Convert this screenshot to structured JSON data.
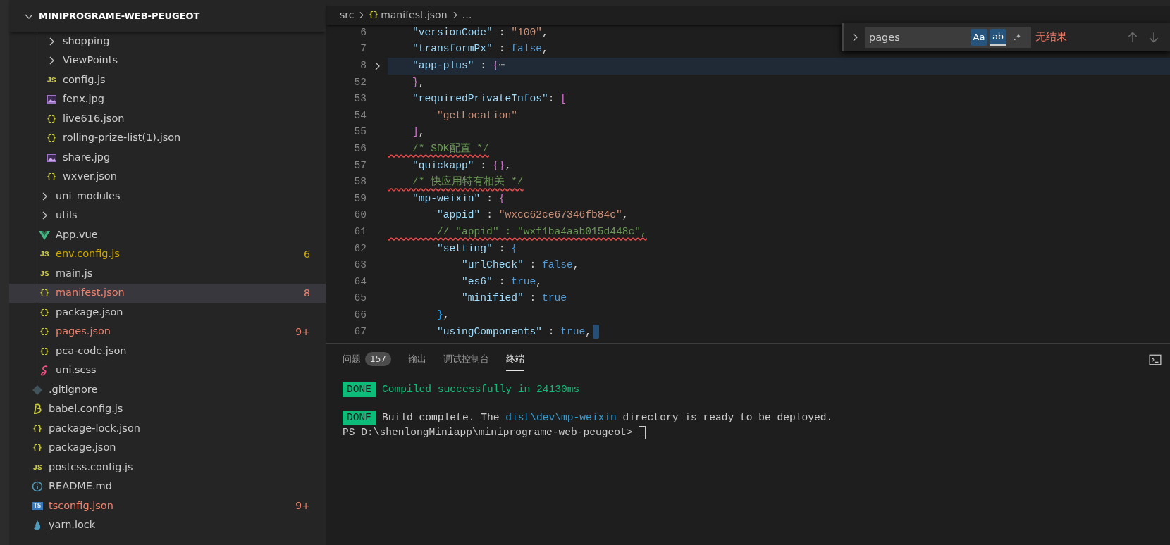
{
  "sidebar": {
    "root": {
      "label": "MINIPROGRAME-WEB-PEUGEOT",
      "expanded": true,
      "children": [
        {
          "children": [
            {
              "children": [
                {
                  "label": "shopping",
                  "kind": "folder",
                  "expanded": false,
                  "selected": false
                },
                {
                  "label": "ViewPoints",
                  "kind": "folder",
                  "expanded": false,
                  "selected": false
                },
                {
                  "label": "config.js",
                  "kind": "js",
                  "icon": "JS",
                  "selected": false
                },
                {
                  "label": "fenx.jpg",
                  "kind": "image",
                  "selected": false
                },
                {
                  "label": "live616.json",
                  "kind": "json",
                  "icon": "{}",
                  "selected": false
                },
                {
                  "label": "rolling-prize-list(1).json",
                  "kind": "json",
                  "icon": "{}",
                  "selected": false
                },
                {
                  "label": "share.jpg",
                  "kind": "image",
                  "selected": false
                },
                {
                  "label": "wxver.json",
                  "kind": "json",
                  "icon": "{}",
                  "selected": false
                }
              ]
            },
            {
              "label": "uni_modules",
              "kind": "folder",
              "expanded": false,
              "selected": false
            },
            {
              "label": "utils",
              "kind": "folder",
              "expanded": false,
              "selected": false
            },
            {
              "label": "App.vue",
              "kind": "vue",
              "selected": false
            },
            {
              "label": "env.config.js",
              "kind": "js",
              "icon": "JS",
              "selected": false,
              "warning": true,
              "badge": "6"
            },
            {
              "label": "main.js",
              "kind": "js",
              "icon": "JS",
              "selected": false
            },
            {
              "label": "manifest.json",
              "kind": "json",
              "icon": "{}",
              "selected": true,
              "error": true,
              "badge": "8"
            },
            {
              "label": "package.json",
              "kind": "json",
              "icon": "{}",
              "selected": false
            },
            {
              "label": "pages.json",
              "kind": "json",
              "icon": "{}",
              "selected": false,
              "error": true,
              "badge": "9+"
            },
            {
              "label": "pca-code.json",
              "kind": "json",
              "icon": "{}",
              "selected": false
            },
            {
              "label": "uni.scss",
              "kind": "scss",
              "selected": false
            }
          ]
        },
        {
          "label": ".gitignore",
          "kind": "git",
          "selected": false
        },
        {
          "label": "babel.config.js",
          "kind": "babel",
          "selected": false
        },
        {
          "label": "package-lock.json",
          "kind": "json",
          "icon": "{}",
          "selected": false
        },
        {
          "label": "package.json",
          "kind": "json",
          "icon": "{}",
          "selected": false
        },
        {
          "label": "postcss.config.js",
          "kind": "js",
          "icon": "JS",
          "selected": false
        },
        {
          "label": "README.md",
          "kind": "info",
          "selected": false
        },
        {
          "label": "tsconfig.json",
          "kind": "ts",
          "icon": "TS",
          "selected": false,
          "error": true,
          "badge": "9+"
        },
        {
          "label": "yarn.lock",
          "kind": "yarn",
          "selected": false
        }
      ]
    }
  },
  "breadcrumb": [
    {
      "text": "src"
    },
    {
      "text": "manifest.json",
      "icon": "{}"
    },
    {
      "text": "…"
    }
  ],
  "code": [
    {
      "number": "6",
      "folded": false,
      "tokens": [
        {
          "kind": "key",
          "text": "    \"versionCode\""
        },
        {
          "kind": "punct",
          "text": " : "
        },
        {
          "kind": "str",
          "text": "\"100\""
        },
        {
          "kind": "punct",
          "text": ","
        }
      ]
    },
    {
      "number": "7",
      "folded": false,
      "tokens": [
        {
          "kind": "key",
          "text": "    \"transformPx\""
        },
        {
          "kind": "punct",
          "text": " : "
        },
        {
          "kind": "bool",
          "text": "false"
        },
        {
          "kind": "punct",
          "text": ","
        }
      ]
    },
    {
      "number": "8",
      "folded": true,
      "tokens": [
        {
          "kind": "key",
          "text": "    \"app-plus\""
        },
        {
          "kind": "punct",
          "text": " : "
        },
        {
          "kind": "b1",
          "text": "{"
        },
        {
          "kind": "ellipsis",
          "text": "⋯"
        }
      ]
    },
    {
      "number": "52",
      "folded": false,
      "tokens": [
        {
          "kind": "b1",
          "text": "    }"
        },
        {
          "kind": "punct",
          "text": ","
        }
      ]
    },
    {
      "number": "53",
      "folded": false,
      "tokens": [
        {
          "kind": "key",
          "text": "    \"requiredPrivateInfos\""
        },
        {
          "kind": "punct",
          "text": ": "
        },
        {
          "kind": "b1",
          "text": "["
        }
      ]
    },
    {
      "number": "54",
      "folded": false,
      "tokens": [
        {
          "kind": "str",
          "text": "        \"getLocation\""
        }
      ]
    },
    {
      "number": "55",
      "folded": false,
      "tokens": [
        {
          "kind": "b1",
          "text": "    ]"
        },
        {
          "kind": "punct",
          "text": ","
        }
      ]
    },
    {
      "number": "56",
      "folded": false,
      "tokens": [
        {
          "kind": "comment",
          "text": "    /* SDK配置 */",
          "error": true
        }
      ]
    },
    {
      "number": "57",
      "folded": false,
      "tokens": [
        {
          "kind": "key",
          "text": "    \"quickapp\""
        },
        {
          "kind": "punct",
          "text": " : "
        },
        {
          "kind": "b1",
          "text": "{}"
        },
        {
          "kind": "punct",
          "text": ","
        }
      ]
    },
    {
      "number": "58",
      "folded": false,
      "tokens": [
        {
          "kind": "comment",
          "text": "    /* 快应用特有相关 */",
          "error": true
        }
      ]
    },
    {
      "number": "59",
      "folded": false,
      "tokens": [
        {
          "kind": "key",
          "text": "    \"mp-weixin\""
        },
        {
          "kind": "punct",
          "text": " : "
        },
        {
          "kind": "b1",
          "text": "{"
        }
      ]
    },
    {
      "number": "60",
      "folded": false,
      "tokens": [
        {
          "kind": "key",
          "text": "        \"appid\""
        },
        {
          "kind": "punct",
          "text": " : "
        },
        {
          "kind": "str",
          "text": "\"wxcc62ce67346fb84c\""
        },
        {
          "kind": "punct",
          "text": ","
        }
      ]
    },
    {
      "number": "61",
      "folded": false,
      "tokens": [
        {
          "kind": "comment",
          "text": "        // \"appid\" : \"wxf1ba4aab015d448c\",",
          "error": true
        }
      ]
    },
    {
      "number": "62",
      "folded": false,
      "tokens": [
        {
          "kind": "key",
          "text": "        \"setting\""
        },
        {
          "kind": "punct",
          "text": " : "
        },
        {
          "kind": "b2",
          "text": "{"
        }
      ]
    },
    {
      "number": "63",
      "folded": false,
      "tokens": [
        {
          "kind": "key",
          "text": "            \"urlCheck\""
        },
        {
          "kind": "punct",
          "text": " : "
        },
        {
          "kind": "bool",
          "text": "false"
        },
        {
          "kind": "punct",
          "text": ","
        }
      ]
    },
    {
      "number": "64",
      "folded": false,
      "tokens": [
        {
          "kind": "key",
          "text": "            \"es6\""
        },
        {
          "kind": "punct",
          "text": " : "
        },
        {
          "kind": "bool",
          "text": "true"
        },
        {
          "kind": "punct",
          "text": ","
        }
      ]
    },
    {
      "number": "65",
      "folded": false,
      "tokens": [
        {
          "kind": "key",
          "text": "            \"minified\""
        },
        {
          "kind": "punct",
          "text": " : "
        },
        {
          "kind": "bool",
          "text": "true"
        }
      ]
    },
    {
      "number": "66",
      "folded": false,
      "tokens": [
        {
          "kind": "b2",
          "text": "        }"
        },
        {
          "kind": "punct",
          "text": ","
        }
      ]
    },
    {
      "number": "67",
      "folded": false,
      "cursor": true,
      "tokens": [
        {
          "kind": "key",
          "text": "        \"usingComponents\""
        },
        {
          "kind": "punct",
          "text": " : "
        },
        {
          "kind": "bool",
          "text": "true"
        },
        {
          "kind": "punct",
          "text": ","
        }
      ]
    }
  ],
  "find": {
    "replace_expanded": false,
    "query": "pages",
    "options": [
      {
        "label": "Aa",
        "on": true,
        "underlined": false
      },
      {
        "label": "ab",
        "on": true,
        "underlined": true
      },
      {
        "label": ".*",
        "on": false,
        "underlined": false
      }
    ],
    "result": "无结果",
    "nav_disabled": true
  },
  "panel": {
    "tabs": [
      {
        "label": "问题",
        "count": "157",
        "selected": false
      },
      {
        "label": "输出",
        "selected": false
      },
      {
        "label": "调试控制台",
        "selected": false
      },
      {
        "label": "终端",
        "selected": true
      }
    ],
    "terminal": [
      {
        "badge": "DONE",
        "parts": [
          {
            "kind": "success",
            "text": "Compiled successfully in 24130ms"
          }
        ]
      },
      {
        "badge": "DONE",
        "parts": [
          {
            "kind": "plain",
            "text": "Build complete. The "
          },
          {
            "kind": "path",
            "text": "dist\\dev\\mp-weixin"
          },
          {
            "kind": "plain",
            "text": " directory is ready to be deployed."
          }
        ]
      },
      {
        "cursor": true,
        "parts": [
          {
            "kind": "plain",
            "text": "PS D:\\shenlongMiniapp\\miniprograme-web-peugeot> "
          }
        ]
      }
    ]
  }
}
